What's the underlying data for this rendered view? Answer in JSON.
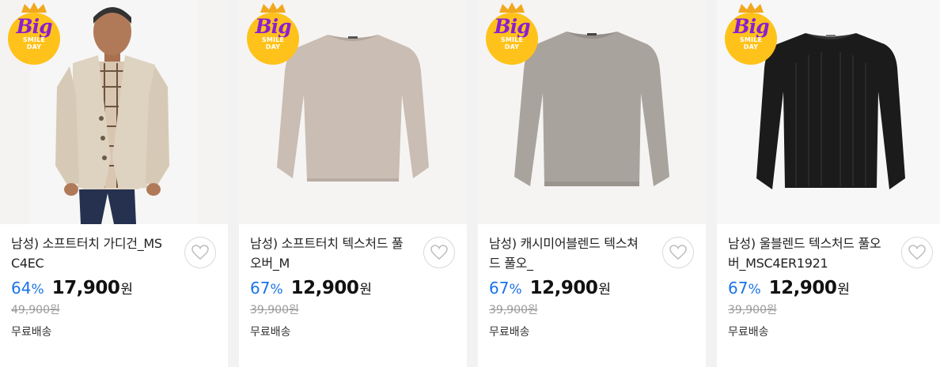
{
  "badge": {
    "big": "Big",
    "line1": "SMILE",
    "line2": "DAY"
  },
  "products": [
    {
      "title": "남성) 소프트터치 가디건_MSC4EC",
      "discount": "64",
      "percent": "%",
      "price": "17,900",
      "currency": "원",
      "original_price": "49,900원",
      "shipping": "무료배송",
      "image": "beige cardigan on model"
    },
    {
      "title": "남성) 소프트터치 텍스처드 풀오버_M",
      "discount": "67",
      "percent": "%",
      "price": "12,900",
      "currency": "원",
      "original_price": "39,900원",
      "shipping": "무료배송",
      "image": "taupe pullover"
    },
    {
      "title": "남성) 캐시미어블렌드 텍스쳐드 풀오_",
      "discount": "67",
      "percent": "%",
      "price": "12,900",
      "currency": "원",
      "original_price": "39,900원",
      "shipping": "무료배송",
      "image": "grey pullover"
    },
    {
      "title": "남성) 울블렌드 텍스처드 풀오버_MSC4ER1921",
      "discount": "67",
      "percent": "%",
      "price": "12,900",
      "currency": "원",
      "original_price": "39,900원",
      "shipping": "무료배송",
      "image": "black pullover"
    }
  ],
  "colors": {
    "discount": "#1a73e8",
    "badge_bg": "#ffc21a",
    "badge_text": "#8a1fd1",
    "card_bg": "#ffffff",
    "page_bg": "#f2f2f2"
  },
  "icons": {
    "wishlist": "heart-icon",
    "badge": "crown-icon"
  }
}
